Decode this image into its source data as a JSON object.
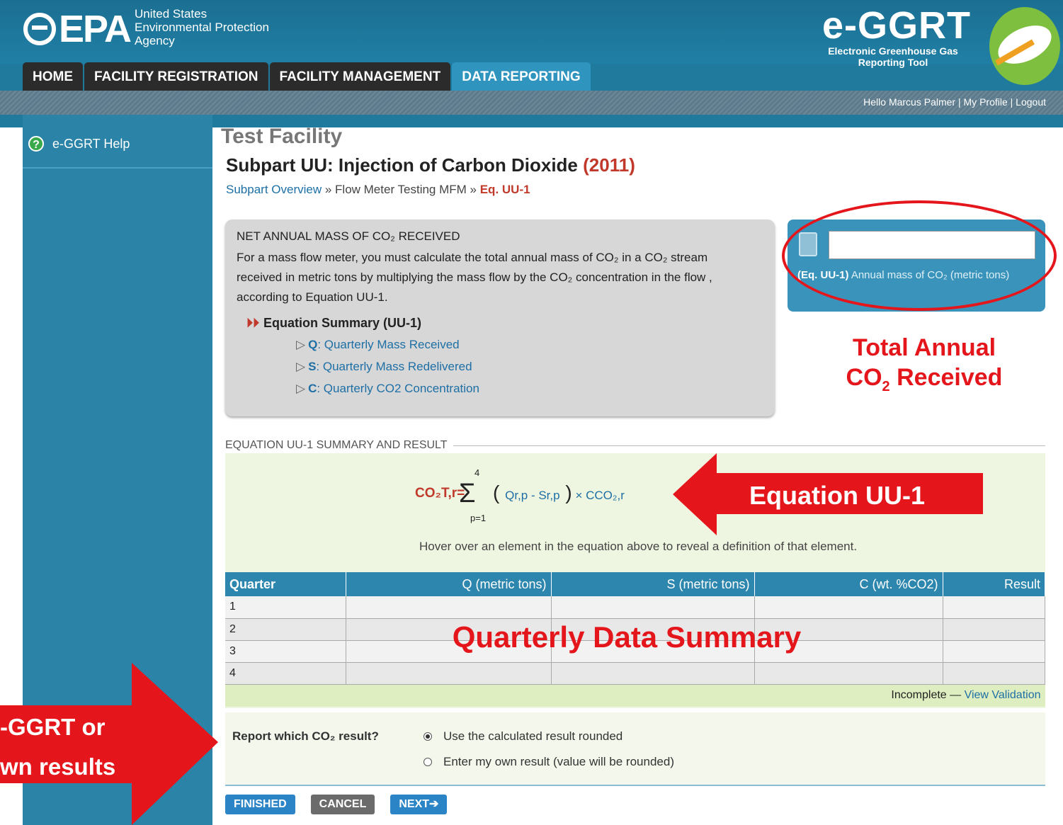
{
  "header": {
    "logo_text": "EPA",
    "logo_sub": [
      "United States",
      "Environmental Protection",
      "Agency"
    ],
    "app_title": "e-GGRT",
    "app_sub": "Electronic Greenhouse Gas Reporting Tool"
  },
  "tabs": [
    {
      "label": "HOME"
    },
    {
      "label": "FACILITY REGISTRATION"
    },
    {
      "label": "FACILITY MANAGEMENT"
    },
    {
      "label": "DATA REPORTING",
      "active": true
    }
  ],
  "userbar": {
    "greeting": "Hello Marcus Palmer",
    "profile": "My Profile",
    "logout": "Logout"
  },
  "sidebar": {
    "help_label": "e-GGRT Help"
  },
  "main": {
    "facility": "Test Facility",
    "subpart": "Subpart UU: Injection of Carbon Dioxide",
    "year": "(2011)",
    "breadcrumb": {
      "overview": "Subpart Overview",
      "sep1": " » ",
      "middle": "Flow Meter Testing MFM",
      "sep2": " » ",
      "current": "Eq. UU-1"
    }
  },
  "info": {
    "title": "NET ANNUAL MASS OF CO₂ RECEIVED",
    "text": "For a mass flow meter, you must calculate the total annual mass of CO₂ in a CO₂ stream received in metric tons by multiplying the mass flow by the CO₂ concentration in the flow , according to Equation UU-1.",
    "summary_title": "Equation Summary (UU-1)",
    "items": [
      {
        "key": "Q",
        "label": ": Quarterly Mass Received"
      },
      {
        "key": "S",
        "label": ": Quarterly Mass Redelivered"
      },
      {
        "key": "C",
        "label": ": Quarterly CO2 Concentration"
      }
    ]
  },
  "calc": {
    "value": "",
    "label_bold": "(Eq. UU-1)",
    "label": " Annual mass of CO₂ (metric tons)"
  },
  "equation": {
    "header": "EQUATION UU-1 SUMMARY AND RESULT",
    "lhs": "CO₂T,r=",
    "sum_top": "4",
    "sum_bot": "p=1",
    "body": "Qr,p - Sr,p",
    "times": "× CCO₂,r",
    "hover_note": "Hover over an element in the equation above to reveal a definition of that element."
  },
  "table": {
    "headers": [
      "Quarter",
      "Q (metric tons)",
      "S (metric tons)",
      "C (wt. %CO2)",
      "Result"
    ],
    "rows": [
      [
        "1",
        "",
        "",
        "",
        ""
      ],
      [
        "2",
        "",
        "",
        "",
        ""
      ],
      [
        "3",
        "",
        "",
        "",
        ""
      ],
      [
        "4",
        "",
        "",
        "",
        ""
      ]
    ],
    "status": "Incomplete — ",
    "status_link": "View Validation"
  },
  "report": {
    "label": "Report which CO₂ result?",
    "option1": "Use the calculated result rounded",
    "option2": "Enter my own result (value will be rounded)",
    "selected": 1
  },
  "buttons": {
    "finished": "FINISHED",
    "cancel": "CANCEL",
    "next": "NEXT➔"
  },
  "annotations": {
    "total_annual_line1": "Total Annual",
    "total_annual_line2": "CO",
    "total_annual_sub": "2",
    "total_annual_line2b": " Received",
    "equation": "Equation UU-1",
    "quarterly": "Quarterly Data Summary",
    "left_line1": "-GGRT or",
    "left_line2": "wn results",
    "color": "#e4161b"
  }
}
